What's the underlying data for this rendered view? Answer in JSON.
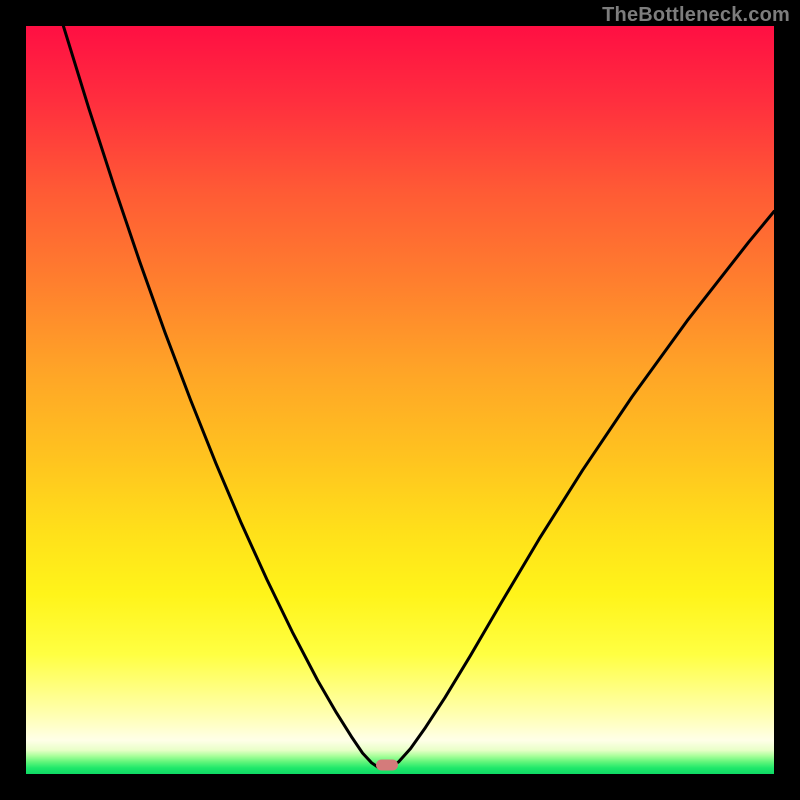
{
  "attribution": "TheBottleneck.com",
  "marker": {
    "x_frac": 0.4826,
    "y_frac": 0.988
  },
  "chart_data": {
    "type": "line",
    "title": "",
    "xlabel": "",
    "ylabel": "",
    "x_range": [
      0,
      1
    ],
    "y_range": [
      0,
      1
    ],
    "note": "Axes are unlabeled in the source image; values are normalized fractions of the plot area. y=0 is the top edge (red), y=1 is the bottom edge (green). The curve represents a bottleneck metric that dips to ~1.0 (optimal/green) near x≈0.48 and rises toward the top (red) away from that point. Background is a vertical heat gradient from red (0) through orange/yellow to green (1).",
    "series": [
      {
        "name": "bottleneck-curve",
        "x": [
          0.05,
          0.084,
          0.118,
          0.152,
          0.186,
          0.22,
          0.254,
          0.288,
          0.322,
          0.356,
          0.39,
          0.415,
          0.435,
          0.45,
          0.462,
          0.472,
          0.482,
          0.498,
          0.514,
          0.534,
          0.56,
          0.594,
          0.636,
          0.686,
          0.744,
          0.81,
          0.884,
          0.966,
          1.0
        ],
        "y": [
          0.0,
          0.11,
          0.215,
          0.315,
          0.41,
          0.5,
          0.585,
          0.665,
          0.74,
          0.81,
          0.875,
          0.918,
          0.95,
          0.972,
          0.985,
          0.992,
          0.993,
          0.984,
          0.966,
          0.938,
          0.898,
          0.842,
          0.77,
          0.686,
          0.594,
          0.496,
          0.394,
          0.289,
          0.248
        ]
      }
    ],
    "highlight_point": {
      "x": 0.4826,
      "y": 0.988
    },
    "background_gradient_stops": [
      {
        "pos": 0.0,
        "color": "#ff0f43"
      },
      {
        "pos": 0.22,
        "color": "#ff5a35"
      },
      {
        "pos": 0.46,
        "color": "#ffa427"
      },
      {
        "pos": 0.68,
        "color": "#ffe11a"
      },
      {
        "pos": 0.84,
        "color": "#ffff42"
      },
      {
        "pos": 0.95,
        "color": "#ffffe8"
      },
      {
        "pos": 1.0,
        "color": "#0fd865"
      }
    ]
  }
}
